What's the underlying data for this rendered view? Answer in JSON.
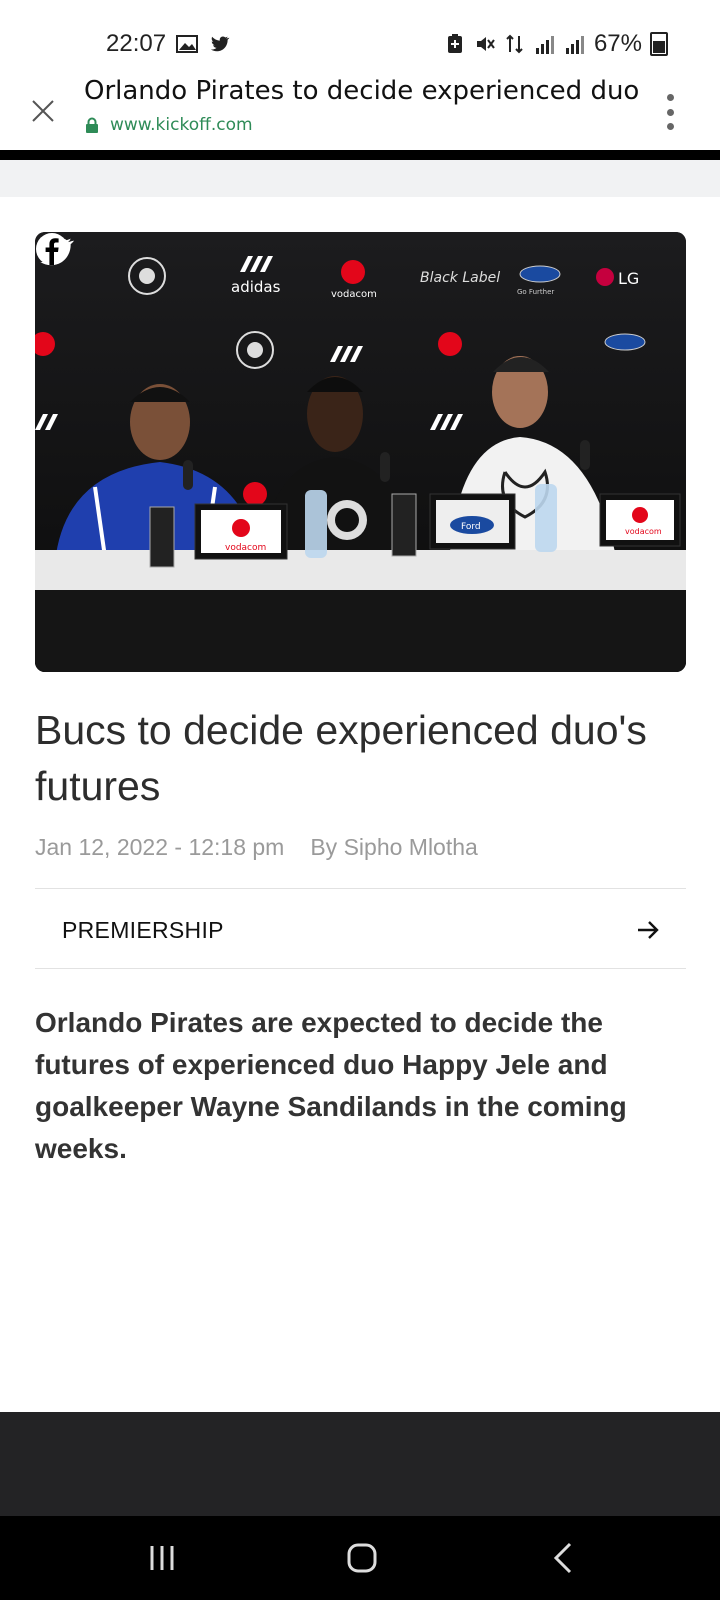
{
  "status": {
    "time": "22:07",
    "battery": "67%"
  },
  "browser": {
    "page_title": "Orlando Pirates to decide experienced duo",
    "url": "www.kickoff.com"
  },
  "article": {
    "headline": "Bucs to decide experienced duo's futures",
    "date": "Jan 12, 2022 - 12:18 pm",
    "author": "By Sipho Mlotha",
    "category": "PREMIERSHIP",
    "lede": "Orlando Pirates are expected to decide the futures of experienced duo Happy Jele and goalkeeper Wayne Sandilands in the coming weeks."
  },
  "hero_image": {
    "sponsor_labels": [
      "adidas",
      "vodacom",
      "Black Label",
      "Go Further",
      "LG"
    ],
    "nameplate_labels": [
      "vodacom",
      "Ford",
      "vodacom"
    ]
  },
  "colors": {
    "url_green": "#2e8b57",
    "headline": "#2d2d2d",
    "meta_grey": "#9a9a9a"
  }
}
